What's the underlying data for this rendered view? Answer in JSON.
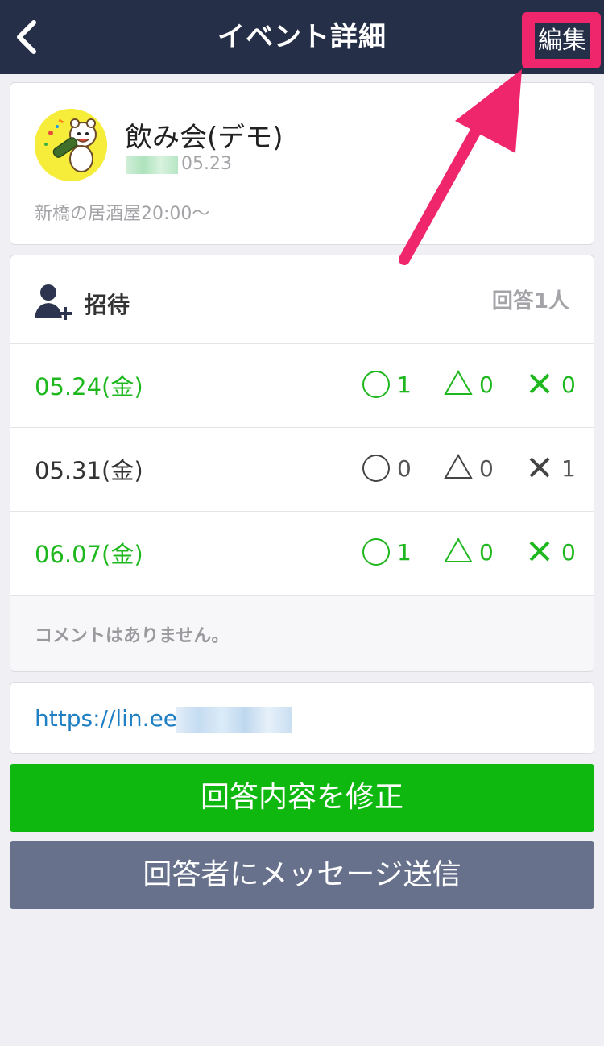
{
  "nav": {
    "title": "イベント詳細",
    "edit_label": "編集"
  },
  "event": {
    "title": "飲み会(デモ)",
    "date": "05.23",
    "description": "新橋の居酒屋20:00〜"
  },
  "invite": {
    "label": "招待",
    "answer_count": "回答1人"
  },
  "dates": [
    {
      "date": "05.24(金)",
      "ok": "1",
      "maybe": "0",
      "ng": "0",
      "active": true
    },
    {
      "date": "05.31(金)",
      "ok": "0",
      "maybe": "0",
      "ng": "1",
      "active": false
    },
    {
      "date": "06.07(金)",
      "ok": "1",
      "maybe": "0",
      "ng": "0",
      "active": true
    }
  ],
  "comment": "コメントはありません。",
  "url": "https://lin.ee/",
  "buttons": {
    "edit_answer": "回答内容を修正",
    "send_message": "回答者にメッセージ送信"
  },
  "colors": {
    "nav": "#262f48",
    "green": "#1eb81e",
    "highlight": "#f0266c",
    "button_gray": "#67718c"
  }
}
